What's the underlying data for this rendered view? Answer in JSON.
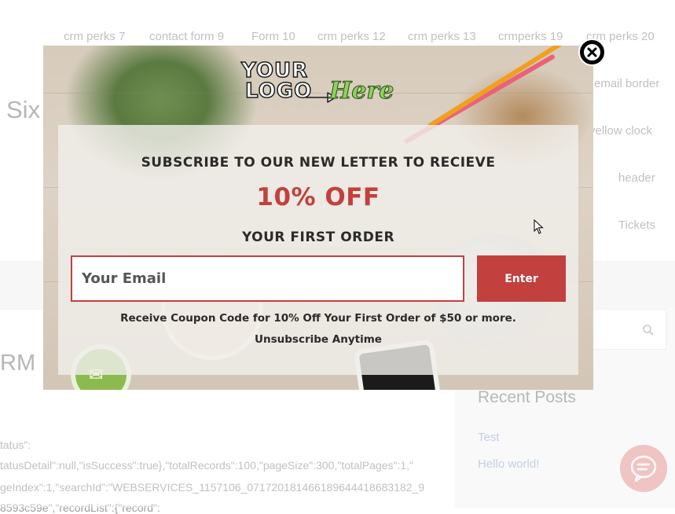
{
  "nav": {
    "items": [
      "crm perks 7",
      "contact form 9",
      "Form 10",
      "crm perks 12",
      "crm perks 13",
      "crmperks 19",
      "crm perks 20"
    ]
  },
  "side_links": [
    "email border",
    "yellow clock",
    "header",
    "Tickets"
  ],
  "site_title": "Six",
  "post_heading": "RM",
  "json_lines": [
    "tatus\":",
    "tatusDetail\":null,\"isSuccess\":true},\"totalRecords\":100,\"pageSize\":300,\"totalPages\":1,\"",
    "geIndex\":1,\"searchId\":\"WEBSERVICES_1157106_07172018146618964441868318​2_9",
    "8593c59e\",\"recordList\":{\"record\":"
  ],
  "sidebar": {
    "recent_posts_heading": "Recent Posts",
    "recent_posts": [
      "Test",
      "Hello world!"
    ]
  },
  "popup": {
    "logo": {
      "line1": "YOUR",
      "line2": "LOGO",
      "accent": "Here"
    },
    "headline": "SUBSCRIBE TO OUR NEW LETTER TO RECIEVE",
    "offer": "10% OFF",
    "subheadline": "YOUR FIRST ORDER",
    "email_placeholder": "Your Email",
    "email_value": "",
    "submit_label": "Enter",
    "coupon_note": "Receive Coupon Code for 10% Off Your First Order of $50 or more.",
    "unsubscribe_note": "Unsubscribe Anytime"
  },
  "icons": {
    "close": "close-icon",
    "search": "search-icon",
    "chat": "chat-icon",
    "cursor": "mouse-cursor"
  },
  "colors": {
    "accent_red": "#c2403d",
    "logo_green": "#8cd35a",
    "chat_bubble": "#e8a0a0",
    "link_blue": "#9fb4d6"
  }
}
